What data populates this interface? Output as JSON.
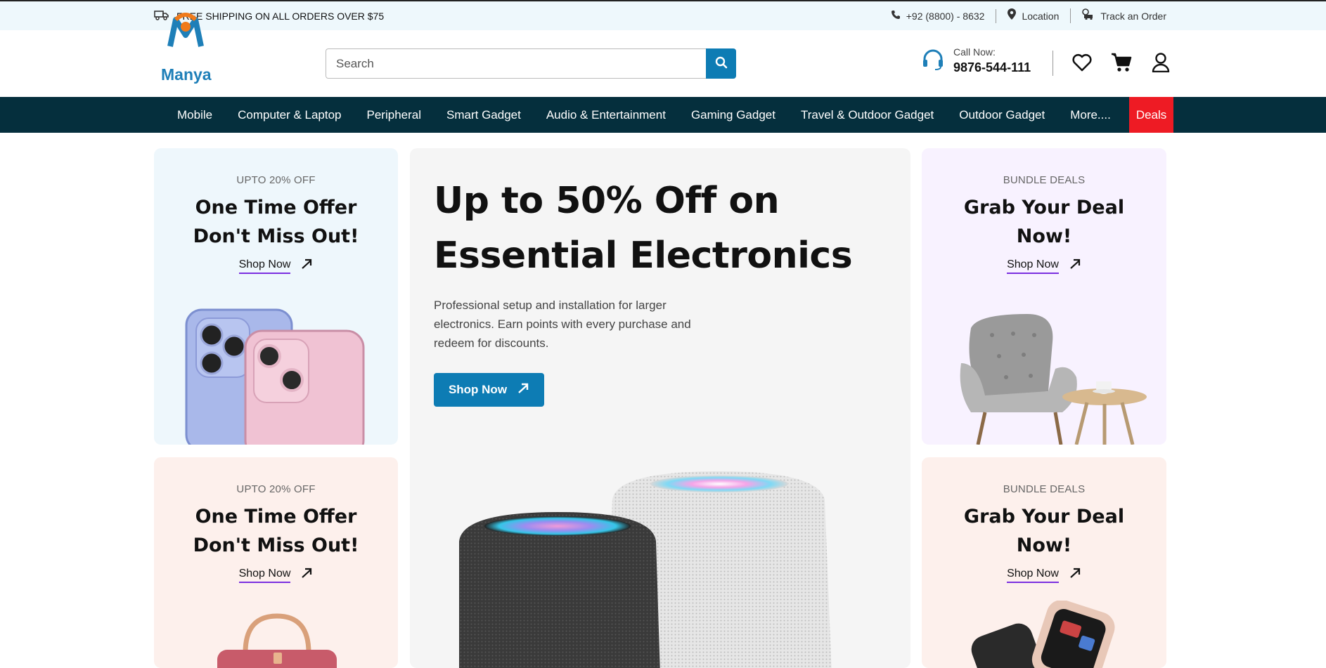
{
  "topbar": {
    "shipping_text": "FREE SHIPPING ON ALL ORDERS OVER $75",
    "phone": "+92 (8800) - 8632",
    "location": "Location",
    "track": "Track an Order"
  },
  "header": {
    "logo_text": "Manya",
    "search_placeholder": "Search",
    "call_label": "Call Now:",
    "call_number": "9876-544-111"
  },
  "nav": {
    "items": [
      "Mobile",
      "Computer & Laptop",
      "Peripheral",
      "Smart Gadget",
      "Audio & Entertainment",
      "Gaming Gadget",
      "Travel & Outdoor Gadget",
      "Outdoor Gadget",
      "More...."
    ],
    "deals": "Deals"
  },
  "cards": [
    {
      "kicker": "UPTO 20% OFF",
      "title_line1": "One Time Offer",
      "title_line2": "Don't Miss Out!",
      "cta": "Shop Now"
    },
    {
      "kicker": "UPTO 20% OFF",
      "title_line1": "One Time Offer",
      "title_line2": "Don't Miss Out!",
      "cta": "Shop Now"
    },
    {
      "kicker": "BUNDLE DEALS",
      "title_line1": "Grab Your Deal",
      "title_line2": "Now!",
      "cta": "Shop Now"
    },
    {
      "kicker": "BUNDLE DEALS",
      "title_line1": "Grab Your Deal",
      "title_line2": "Now!",
      "cta": "Shop Now"
    }
  ],
  "hero": {
    "title_line1": "Up to 50% Off on",
    "title_line2": "Essential Electronics",
    "description": "Professional setup and installation for larger electronics. Earn points with every purchase and redeem for discounts.",
    "cta": "Shop Now"
  },
  "colors": {
    "brand_blue": "#0d7cb4",
    "nav_bg": "#052f3d",
    "deals_red": "#ee1b24",
    "accent_purple": "#7b2fe0"
  },
  "icons": [
    "truck-icon",
    "phone-icon",
    "location-pin-icon",
    "track-order-icon",
    "search-icon",
    "headset-icon",
    "heart-icon",
    "cart-icon",
    "user-icon",
    "arrow-up-right-icon"
  ]
}
